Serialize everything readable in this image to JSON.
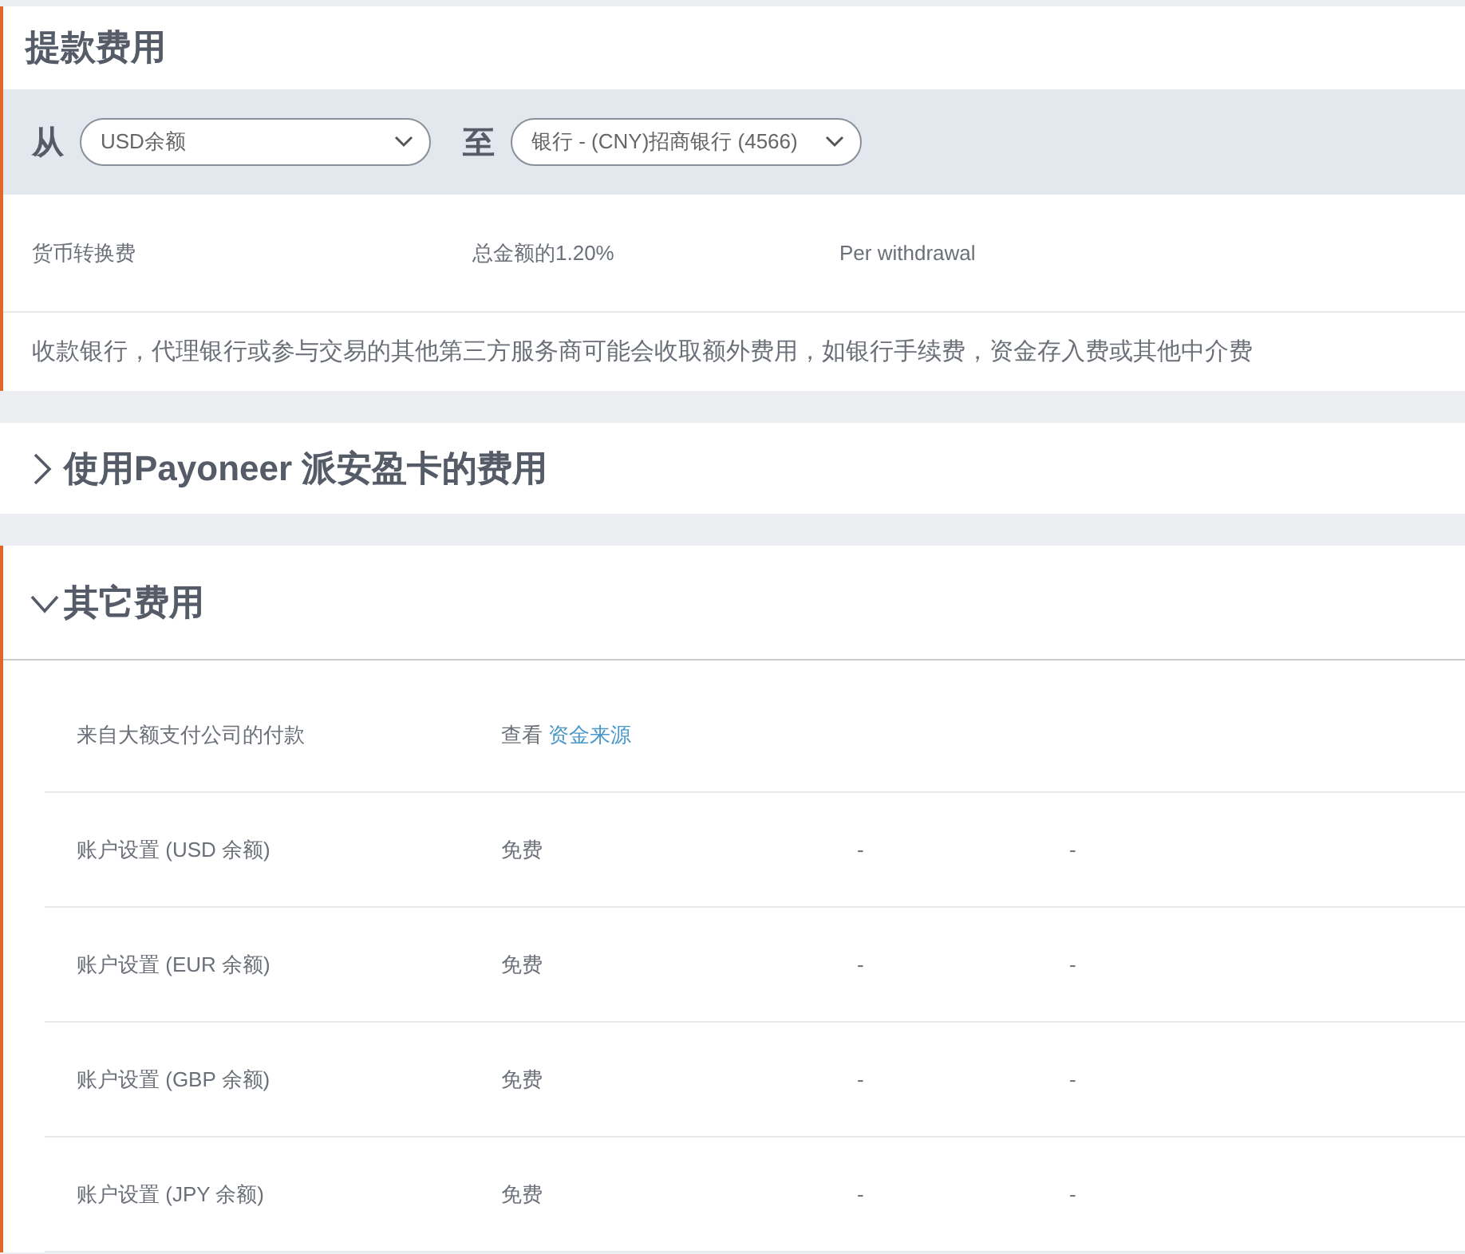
{
  "withdrawal_fees": {
    "title": "提款费用",
    "from_label": "从",
    "from_select": "USD余额",
    "to_label": "至",
    "to_select": "银行 - (CNY)招商银行 (4566)",
    "fees": [
      {
        "name": "货币转换费",
        "amount": "总金额的1.20%",
        "basis": "Per withdrawal"
      }
    ],
    "note": "收款银行，代理银行或参与交易的其他第三方服务商可能会收取额外费用，如银行手续费，资金存入费或其他中介费"
  },
  "card_fees": {
    "title": "使用Payoneer 派安盈卡的费用",
    "expanded": false
  },
  "other_fees": {
    "title": "其它费用",
    "expanded": true,
    "rows": [
      {
        "label": "来自大额支付公司的付款",
        "value": "查看",
        "link": "资金来源"
      },
      {
        "label": "账户设置 (USD 余额)",
        "value": "免费",
        "column_3": "-",
        "column_4": "-"
      },
      {
        "label": "账户设置 (EUR 余额)",
        "value": "免费",
        "column_3": "-",
        "column_4": "-"
      },
      {
        "label": "账户设置 (GBP 余额)",
        "value": "免费",
        "column_3": "-",
        "column_4": "-"
      },
      {
        "label": "账户设置 (JPY 余额)",
        "value": "免费",
        "column_3": "-",
        "column_4": "-"
      }
    ]
  }
}
